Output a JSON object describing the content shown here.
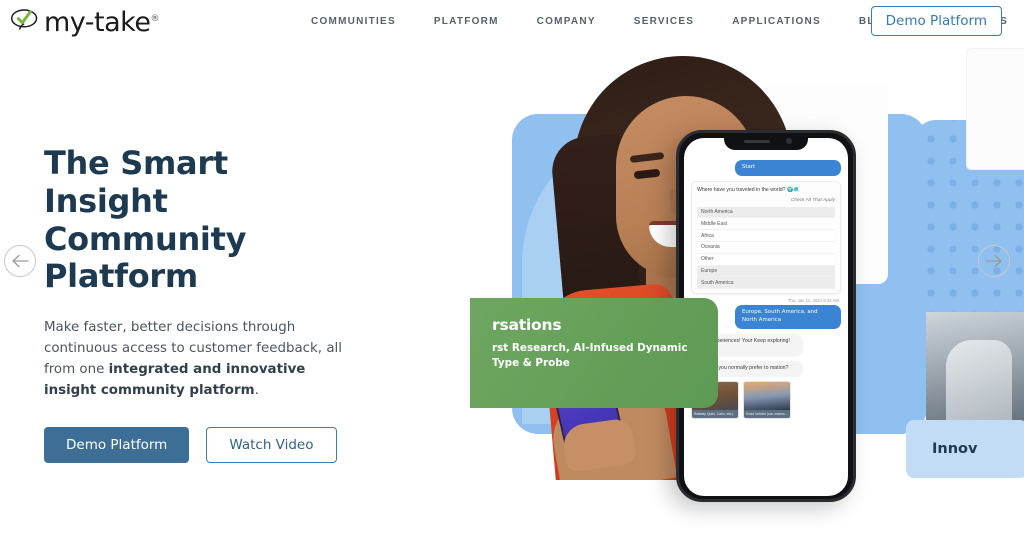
{
  "header": {
    "logo": {
      "text": "my-take",
      "registered": "®",
      "icon": "checkmark-bubble-logo"
    },
    "nav_items": [
      {
        "label": "COMMUNITIES"
      },
      {
        "label": "PLATFORM"
      },
      {
        "label": "COMPANY"
      },
      {
        "label": "SERVICES"
      },
      {
        "label": "APPLICATIONS"
      },
      {
        "label": "BLOG"
      },
      {
        "label": "CONTACT US"
      }
    ],
    "cta_label": "Demo Platform"
  },
  "hero": {
    "title_line1": "The Smart",
    "title_line2": "Insight Community",
    "title_line3": "Platform",
    "paragraph_part1": "Make faster, better decisions through continuous access to customer feedback, all from one ",
    "paragraph_bold": "integrated and innovative insight community platform",
    "paragraph_end": ".",
    "primary_button": "Demo Platform",
    "secondary_button": "Watch Video",
    "prev_arrow": "←",
    "next_arrow": "→"
  },
  "green_card": {
    "title": "rsations",
    "subtitle_line1": "rst Research, AI-Infused Dynamic",
    "subtitle_line2": "Type & Probe"
  },
  "phone": {
    "start_bubble": "Start",
    "question": "Where have you traveled in the world?",
    "question_emoji": "🌍🗺️",
    "instruction": "Check All That Apply",
    "options": [
      {
        "label": "North America",
        "selected": true
      },
      {
        "label": "Middle East",
        "selected": false
      },
      {
        "label": "Africa",
        "selected": false
      },
      {
        "label": "Oceania",
        "selected": false
      },
      {
        "label": "Other",
        "selected": false
      },
      {
        "label": "Europe",
        "selected": true
      },
      {
        "label": "South America",
        "selected": true
      }
    ],
    "timestamp": "Thu, Jan 11, 2024 6:22 AM",
    "answer_bubble": "Europe, South America, and North America",
    "reply_bubble": "travel experiences! Your Keep exploring! 🌎👍",
    "followup_bubble": "travel do you normally prefer to mation?",
    "thumbnails": [
      {
        "caption": "Railway Quito, Cairo, etc.)"
      },
      {
        "caption": "Road Vehicle (car, motorc..."
      }
    ]
  },
  "next_slide": {
    "title_partial": "Innov"
  },
  "colors": {
    "navy": "#1d3a50",
    "blue_accent": "#3d7ab0",
    "button_blue": "#3d6e96",
    "green_card": "#5d9a53",
    "panel_blue": "#8fc0ef",
    "light_card_blue": "#c3dcf6",
    "logo_green": "#7bb53f"
  }
}
